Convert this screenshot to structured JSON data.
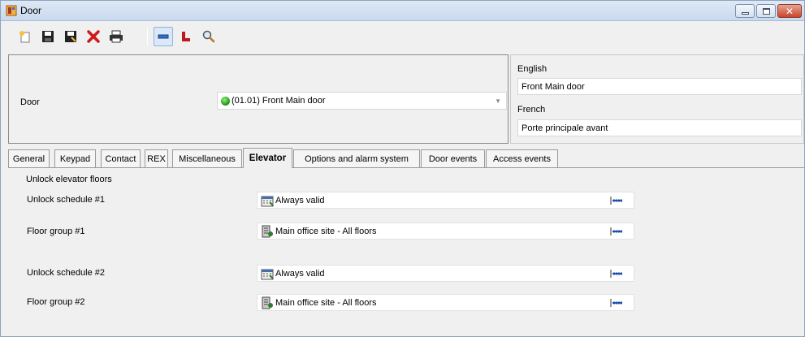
{
  "window": {
    "title": "Door"
  },
  "toolbar": {
    "buttons": [
      "new-icon",
      "save-icon",
      "save-as-icon",
      "delete-icon",
      "print-icon",
      "door-view-icon",
      "link-icon",
      "search-icon"
    ]
  },
  "header": {
    "door_label": "Door",
    "door_value": "(01.01) Front Main door",
    "english_label": "English",
    "english_value": "Front Main door",
    "french_label": "French",
    "french_value": "Porte principale avant"
  },
  "tabs": [
    {
      "label": "General"
    },
    {
      "label": "Keypad"
    },
    {
      "label": "Contact"
    },
    {
      "label": "REX"
    },
    {
      "label": "Miscellaneous"
    },
    {
      "label": "Elevator",
      "active": true
    },
    {
      "label": "Options and alarm system"
    },
    {
      "label": "Door events"
    },
    {
      "label": "Access events"
    }
  ],
  "elevator": {
    "section_title": "Unlock elevator floors",
    "rows": [
      {
        "label": "Unlock schedule #1",
        "value": "Always valid",
        "icon": "schedule-icon"
      },
      {
        "label": "Floor group #1",
        "value": "Main office site - All floors",
        "icon": "floor-group-icon"
      },
      {
        "label": "Unlock schedule #2",
        "value": "Always valid",
        "icon": "schedule-icon"
      },
      {
        "label": "Floor group #2",
        "value": "Main office site - All floors",
        "icon": "floor-group-icon"
      }
    ]
  }
}
